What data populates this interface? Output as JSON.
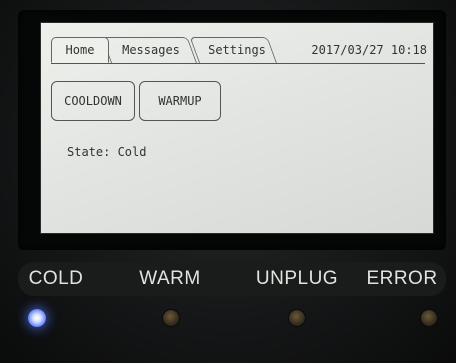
{
  "screen": {
    "tabs": [
      {
        "label": "Home"
      },
      {
        "label": "Messages"
      },
      {
        "label": "Settings"
      }
    ],
    "datetime": "2017/03/27 10:18",
    "buttons": {
      "cooldown": "COOLDOWN",
      "warmup": "WARMUP"
    },
    "state_text": "State: Cold"
  },
  "indicators": [
    {
      "label": "COLD",
      "led": "on",
      "led_color": "#6f8cff"
    },
    {
      "label": "WARM",
      "led": "off"
    },
    {
      "label": "UNPLUG",
      "led": "off"
    },
    {
      "label": "ERROR",
      "led": "off"
    }
  ]
}
